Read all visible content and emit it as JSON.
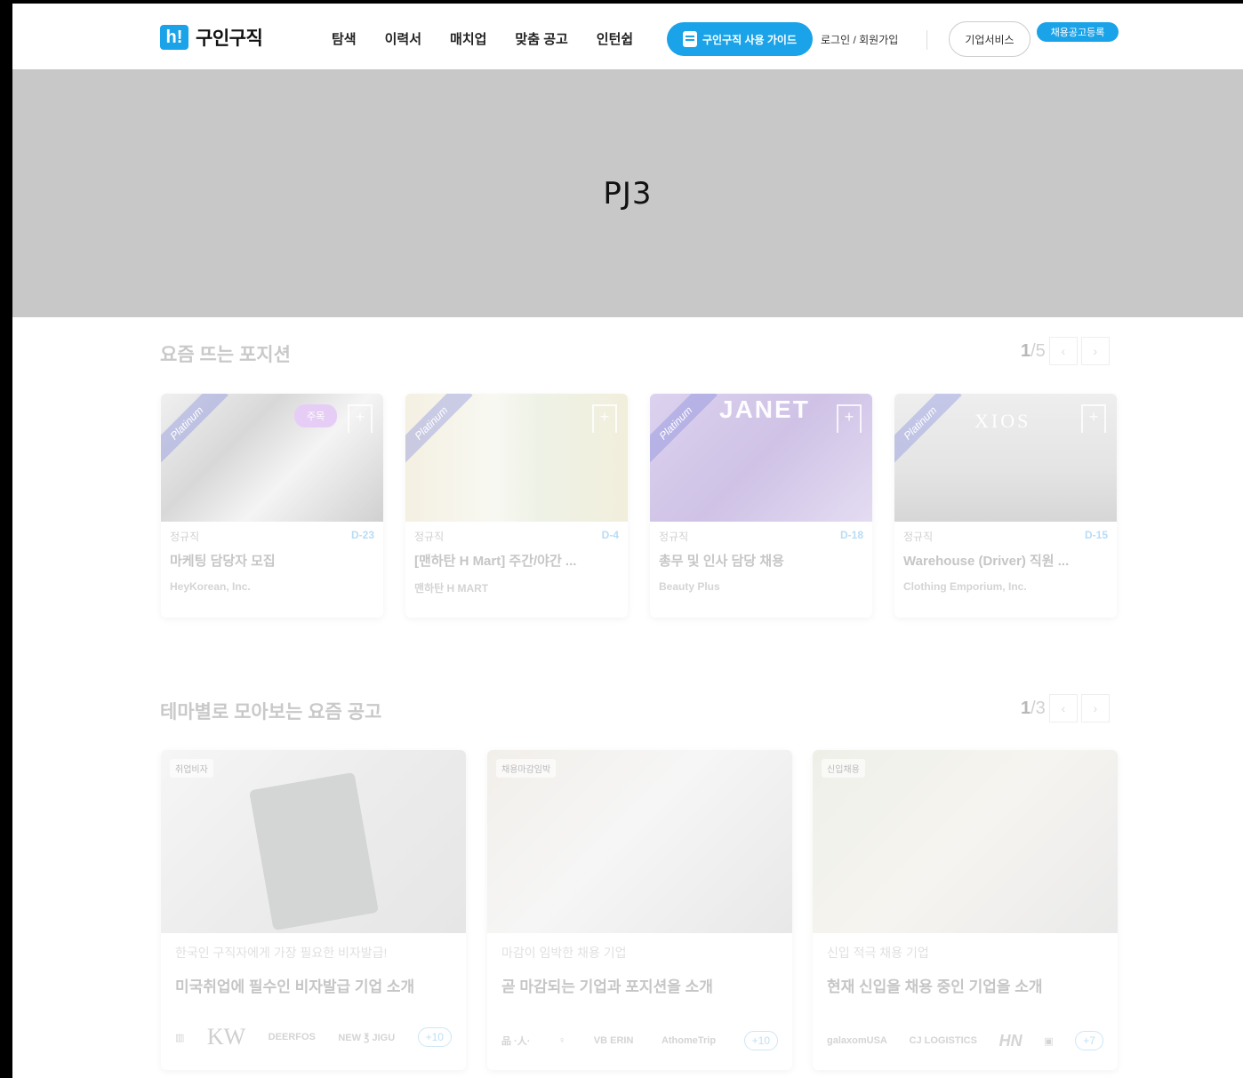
{
  "header": {
    "logo_mark": "h!",
    "logo_text": "구인구직",
    "nav": [
      "탐색",
      "이력서",
      "매치업",
      "맞춤 공고",
      "인턴쉽"
    ],
    "guide_button": "구인구직 사용 가이드",
    "login": "로그인 / 회원가입",
    "corp_service": "기업서비스",
    "post_job": "채용공고등록"
  },
  "banner": {
    "text": "PJ3"
  },
  "hot_positions": {
    "title": "요즘 뜨는 포지션",
    "page_current": "1",
    "page_total": "/5",
    "cards": [
      {
        "ribbon": "Platinum",
        "badge": "주목",
        "type": "정규직",
        "dday": "D-23",
        "title": "마케팅 담당자 모집",
        "company": "HeyKorean, Inc."
      },
      {
        "ribbon": "Platinum",
        "badge": "",
        "type": "정규직",
        "dday": "D-4",
        "title": "[맨하탄 H Mart] 주간/야간 ...",
        "company": "맨하탄 H MART"
      },
      {
        "ribbon": "Platinum",
        "badge": "",
        "type": "정규직",
        "dday": "D-18",
        "title": "총무 및 인사 담당 채용",
        "company": "Beauty Plus",
        "img_text": "JANET"
      },
      {
        "ribbon": "Platinum",
        "badge": "",
        "type": "정규직",
        "dday": "D-15",
        "title": "Warehouse (Driver) 직원 ...",
        "company": "Clothing Emporium, Inc.",
        "img_text": "XIOS"
      }
    ]
  },
  "themes": {
    "title": "테마별로 모아보는 요즘 공고",
    "page_current": "1",
    "page_total": "/3",
    "cards": [
      {
        "tag": "취업비자",
        "sub": "한국인 구직자에게 가장 필요한 비자발급!",
        "title": "미국취업에 필수인 비자발급 기업 소개",
        "logos": [
          "▥",
          "KW",
          "DEERFOS",
          "NEW ℥ JIGU"
        ],
        "more": "+10"
      },
      {
        "tag": "채용마감임박",
        "sub": "마감이 임박한 채용 기업",
        "title": "곧 마감되는 기업과 포지션을 소개",
        "logos": [
          "品 ·人·",
          "♀",
          "VB ERIN",
          "AthomeTrip"
        ],
        "more": "+10"
      },
      {
        "tag": "신입채용",
        "sub": "신입 적극 채용 기업",
        "title": "현재 신입을 채용 중인 기업을 소개",
        "logos": [
          "galaxomUSA",
          "CJ LOGISTICS",
          "HN",
          "▣"
        ],
        "more": "+7"
      }
    ]
  },
  "colors": {
    "accent": "#1aa3e8",
    "banner_bg": "#c8c8c8"
  }
}
